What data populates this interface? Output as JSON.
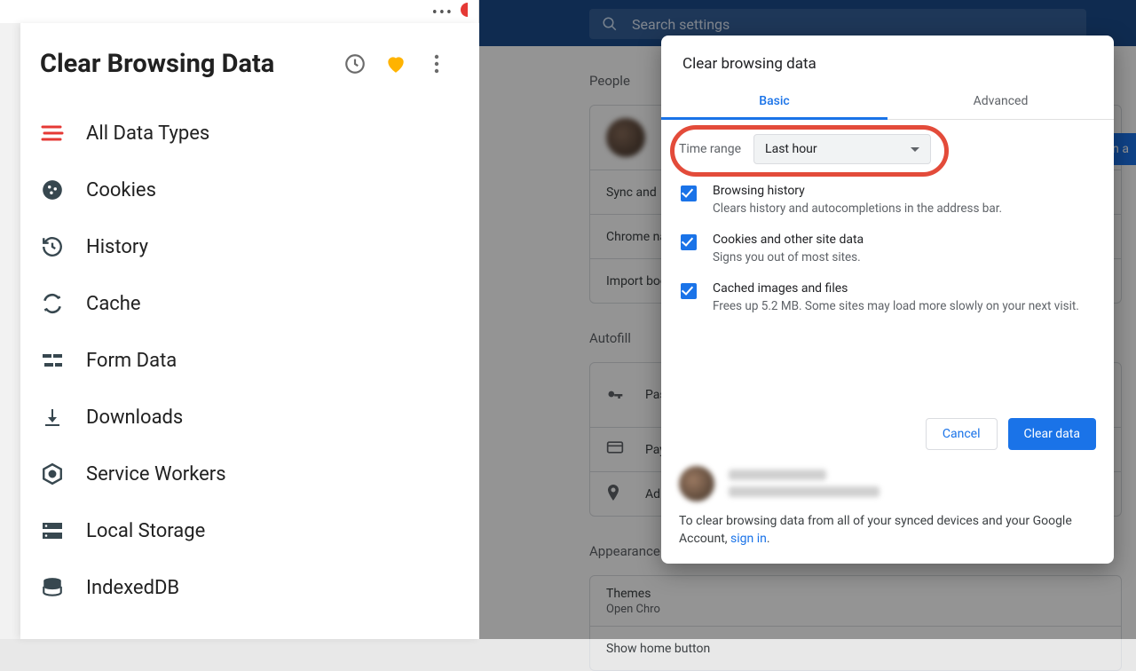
{
  "left_panel": {
    "title": "Clear Browsing Data",
    "items": [
      {
        "id": "all",
        "label": "All Data Types"
      },
      {
        "id": "cookies",
        "label": "Cookies"
      },
      {
        "id": "history",
        "label": "History"
      },
      {
        "id": "cache",
        "label": "Cache"
      },
      {
        "id": "form",
        "label": "Form Data"
      },
      {
        "id": "downloads",
        "label": "Downloads"
      },
      {
        "id": "sw",
        "label": "Service Workers"
      },
      {
        "id": "ls",
        "label": "Local Storage"
      },
      {
        "id": "idb",
        "label": "IndexedDB"
      }
    ]
  },
  "settings_bg": {
    "search_placeholder": "Search settings",
    "sections": {
      "people": "People",
      "autofill": "Autofill",
      "appearance": "Appearance"
    },
    "people_rows": {
      "sync": "Sync and",
      "chrome_name": "Chrome na",
      "import": "Import boo"
    },
    "autofill_rows": {
      "passwords": "Pas",
      "payments": "Pay",
      "addresses": "Ad"
    },
    "appearance_rows": {
      "themes": "Themes",
      "themes_sub": "Open Chro",
      "show_home": "Show home button"
    },
    "corner_button": "n in a"
  },
  "dialog": {
    "title": "Clear browsing data",
    "tabs": {
      "basic": "Basic",
      "advanced": "Advanced"
    },
    "time_range": {
      "label": "Time range",
      "value": "Last hour"
    },
    "options": [
      {
        "title": "Browsing history",
        "desc": "Clears history and autocompletions in the address bar."
      },
      {
        "title": "Cookies and other site data",
        "desc": "Signs you out of most sites."
      },
      {
        "title": "Cached images and files",
        "desc": "Frees up 5.2 MB. Some sites may load more slowly on your next visit."
      }
    ],
    "actions": {
      "cancel": "Cancel",
      "clear": "Clear data"
    },
    "footer_text": "To clear browsing data from all of your synced devices and your Google Account, ",
    "footer_link": "sign in",
    "footer_tail": "."
  }
}
